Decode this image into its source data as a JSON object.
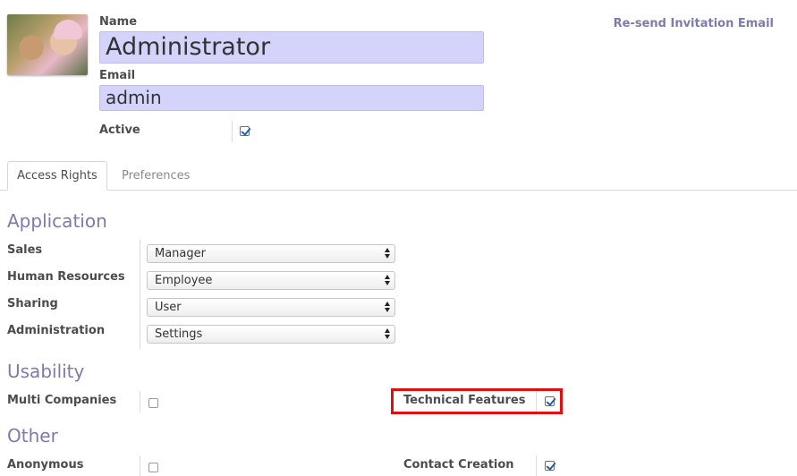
{
  "header": {
    "name_label": "Name",
    "name_value": "Administrator",
    "email_label": "Email",
    "email_value": "admin",
    "active_label": "Active",
    "active_checked": true,
    "resend_link": "Re-send Invitation Email"
  },
  "tabs": [
    {
      "label": "Access Rights",
      "active": true
    },
    {
      "label": "Preferences",
      "active": false
    }
  ],
  "application": {
    "title": "Application",
    "rows": [
      {
        "label": "Sales",
        "value": "Manager"
      },
      {
        "label": "Human Resources",
        "value": "Employee"
      },
      {
        "label": "Sharing",
        "value": "User"
      },
      {
        "label": "Administration",
        "value": "Settings"
      }
    ]
  },
  "usability": {
    "title": "Usability",
    "multi_companies_label": "Multi Companies",
    "multi_companies_checked": false,
    "technical_features_label": "Technical Features",
    "technical_features_checked": true
  },
  "other": {
    "title": "Other",
    "anonymous_label": "Anonymous",
    "anonymous_checked": false,
    "contact_creation_label": "Contact Creation",
    "contact_creation_checked": true
  },
  "colors": {
    "accent": "#7c7bad",
    "input_bg": "#d3d3fb",
    "highlight_border": "#e01010"
  }
}
